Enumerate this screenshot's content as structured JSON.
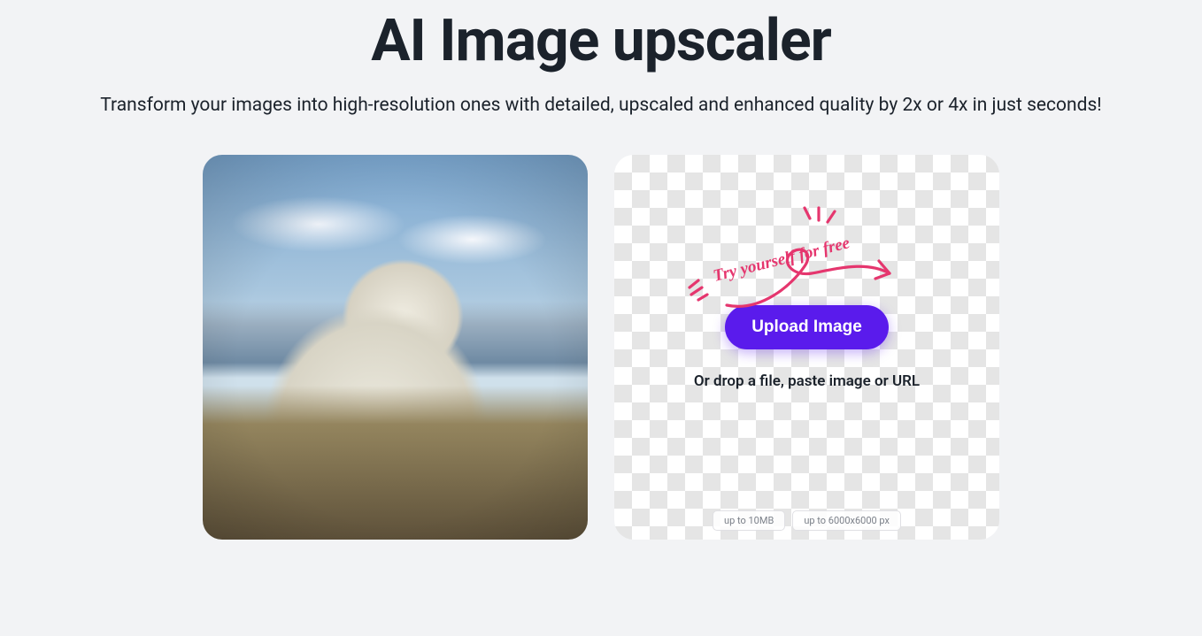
{
  "header": {
    "title": "AI Image upscaler",
    "subtitle": "Transform your images into high-resolution ones with detailed, upscaled and enhanced quality by 2x or 4x in just seconds!"
  },
  "callout": {
    "text": "Try yourself for free"
  },
  "dropzone": {
    "upload_label": "Upload Image",
    "instruction": "Or drop a file, paste image or URL",
    "limits": {
      "size": "up to 10MB",
      "dimensions": "up to 6000x6000 px"
    }
  }
}
